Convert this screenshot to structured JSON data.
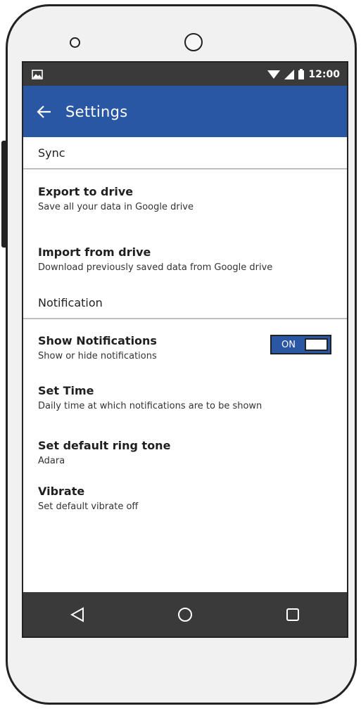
{
  "status_bar": {
    "time": "12:00",
    "icons": [
      "image-notification-icon",
      "wifi-icon",
      "signal-icon",
      "battery-icon"
    ]
  },
  "app_bar": {
    "back_icon": "back-arrow-icon",
    "title": "Settings"
  },
  "sections": {
    "sync": {
      "header": "Sync",
      "items": {
        "export": {
          "title": "Export to drive",
          "summary": "Save all your data in Google drive"
        },
        "import": {
          "title": "Import from drive",
          "summary": "Download previously saved data from Google drive"
        }
      }
    },
    "notification": {
      "header": "Notification",
      "items": {
        "show": {
          "title": "Show Notifications",
          "summary": "Show or hide notifications",
          "toggle_label": "ON",
          "toggle_state": true
        },
        "time": {
          "title": "Set Time",
          "summary": "Daily time at which notifications are to be shown"
        },
        "ringtone": {
          "title": "Set default ring tone",
          "summary": "Adara"
        },
        "vibrate": {
          "title": "Vibrate",
          "summary": "Set default vibrate off"
        }
      }
    }
  },
  "nav_bar": {
    "icons": [
      "back-triangle-icon",
      "home-circle-icon",
      "recents-square-icon"
    ]
  },
  "colors": {
    "primary": "#2957a4",
    "status_bar": "#3a3a3a",
    "nav_bar": "#3a3a3a",
    "divider": "#bfbfbf"
  }
}
